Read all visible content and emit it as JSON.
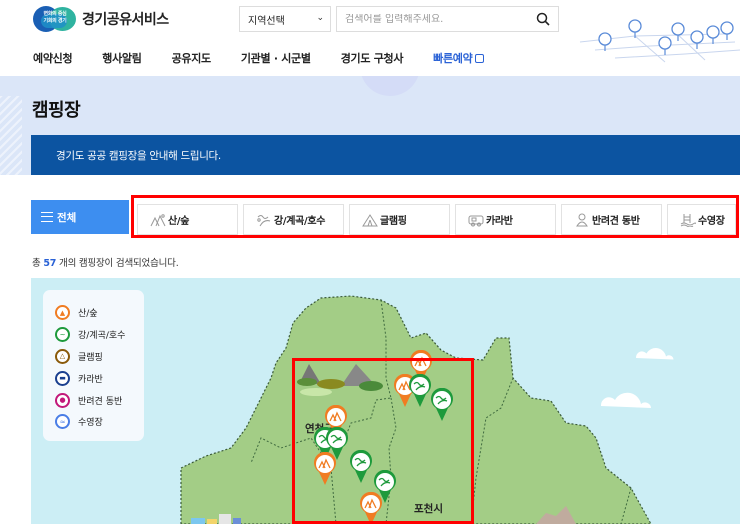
{
  "header": {
    "logo_badge_line1": "변화의 중심",
    "logo_badge_line2": "기회의 경기",
    "logo_text": "경기공유서비스",
    "region_select": {
      "selected": "지역선택"
    },
    "search": {
      "placeholder": "검색어를 입력해주세요.",
      "value": ""
    },
    "nav": [
      {
        "label": "예약신청"
      },
      {
        "label": "행사알림"
      },
      {
        "label": "공유지도"
      },
      {
        "label": "기관별 · 시군별"
      },
      {
        "label": "경기도 구청사"
      },
      {
        "label": "빠른예약"
      }
    ]
  },
  "hero": {
    "title": "캠핑장",
    "notice": "경기도 공공 캠핑장을 안내해 드립니다."
  },
  "filters": {
    "all_label": "전체",
    "tabs": [
      {
        "label": "산/숲",
        "icon": "mountain-forest-icon"
      },
      {
        "label": "강/계곡/호수",
        "icon": "river-lake-icon"
      },
      {
        "label": "글램핑",
        "icon": "glamping-tent-icon"
      },
      {
        "label": "카라반",
        "icon": "caravan-icon"
      },
      {
        "label": "반려견 동반",
        "icon": "pet-dog-icon"
      },
      {
        "label": "수영장",
        "icon": "swimming-pool-icon"
      }
    ]
  },
  "results": {
    "prefix": "총",
    "count": "57",
    "suffix": "개의 캠핑장이 검색되었습니다."
  },
  "map": {
    "legend": [
      {
        "label": "산/숲",
        "color": "#f07c22"
      },
      {
        "label": "강/계곡/호수",
        "color": "#1e9a3c"
      },
      {
        "label": "글램핑",
        "color": "#8a5a0a"
      },
      {
        "label": "카라반",
        "color": "#1a3f8f"
      },
      {
        "label": "반려견 동반",
        "color": "#c2187a"
      },
      {
        "label": "수영장",
        "color": "#4a7ee6"
      }
    ],
    "regions": [
      {
        "name": "연천군"
      },
      {
        "name": "포천시"
      }
    ]
  },
  "colors": {
    "accent": "#3d8ef0",
    "notice_bg": "#0c54a1",
    "highlight": "#ff0000",
    "map_water": "#cceef5",
    "map_land": "#a3cd86"
  }
}
